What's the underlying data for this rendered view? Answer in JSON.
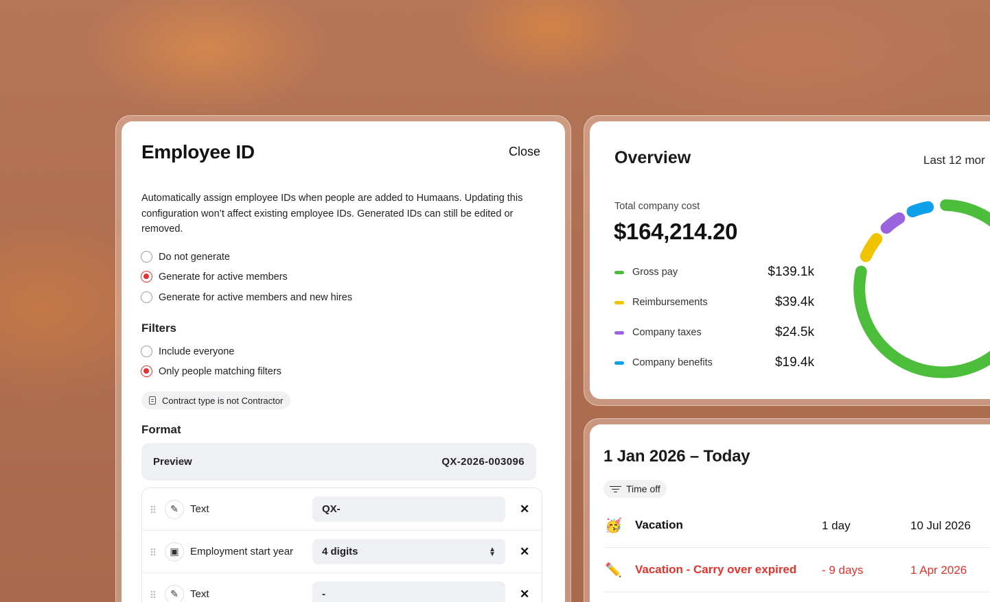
{
  "employee_id_dialog": {
    "title": "Employee ID",
    "close_label": "Close",
    "description": "Automatically assign employee IDs when people are added to Humaans. Updating this configuration won’t affect existing employee IDs. Generated IDs can still be edited or removed.",
    "generate_options": [
      {
        "label": "Do not generate",
        "selected": false
      },
      {
        "label": "Generate for active members",
        "selected": true
      },
      {
        "label": "Generate for active members and new hires",
        "selected": false
      }
    ],
    "filters_heading": "Filters",
    "filter_options": [
      {
        "label": "Include everyone",
        "selected": false
      },
      {
        "label": "Only people matching filters",
        "selected": true
      }
    ],
    "filter_chip": "Contract type is not Contractor",
    "format_heading": "Format",
    "preview_label": "Preview",
    "preview_value": "QX-2026-003096",
    "format_rows": [
      {
        "icon": "pencil-icon",
        "label": "Text",
        "value": "QX-"
      },
      {
        "icon": "calendar-icon",
        "label": "Employment start year",
        "value": "4 digits",
        "select": true
      },
      {
        "icon": "pencil-icon",
        "label": "Text",
        "value": "-"
      }
    ]
  },
  "overview": {
    "title": "Overview",
    "range_label": "Last 12 mor",
    "total_label": "Total company cost",
    "total_value": "$164,214.20",
    "legend": [
      {
        "name": "Gross pay",
        "amount": "$139.1k",
        "color": "#4cbe3c"
      },
      {
        "name": "Reimbursements",
        "amount": "$39.4k",
        "color": "#f0c400"
      },
      {
        "name": "Company taxes",
        "amount": "$24.5k",
        "color": "#9b63e0"
      },
      {
        "name": "Company benefits",
        "amount": "$19.4k",
        "color": "#0ea0e8"
      }
    ]
  },
  "time_off": {
    "title": "1 Jan 2026 – Today",
    "chip_label": "Time off",
    "rows": [
      {
        "emoji": "🥳",
        "name": "Vacation",
        "duration": "1 day",
        "date": "10 Jul 2026",
        "negative": false
      },
      {
        "emoji": "✏️",
        "name": "Vacation - Carry over expired",
        "duration": "- 9 days",
        "date": "1 Apr 2026",
        "negative": true
      }
    ]
  }
}
